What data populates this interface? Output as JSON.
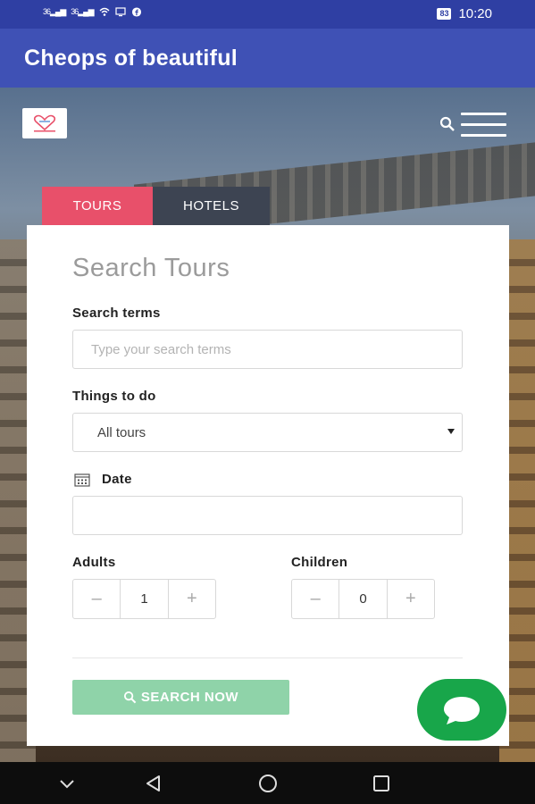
{
  "status_bar": {
    "signal_1": "36",
    "signal_2": "36",
    "battery": "83",
    "time": "10:20",
    "icons": [
      "signal-icon",
      "signal-icon",
      "wifi-icon",
      "screen-cast-icon",
      "facebook-icon"
    ]
  },
  "app_bar": {
    "title": "Cheops of beautiful"
  },
  "tabs": [
    {
      "label": "TOURS",
      "active": true
    },
    {
      "label": "HOTELS",
      "active": false
    }
  ],
  "form": {
    "title": "Search Tours",
    "search_terms_label": "Search terms",
    "search_terms_placeholder": "Type your search terms",
    "things_to_do_label": "Things to do",
    "things_to_do_value": "All tours",
    "date_label": "Date",
    "date_value": "",
    "adults_label": "Adults",
    "adults_value": "1",
    "children_label": "Children",
    "children_value": "0",
    "minus": "–",
    "plus": "+",
    "search_button": "SEARCH NOW"
  },
  "colors": {
    "status_bar": "#2f3fa3",
    "app_bar": "#3f51b5",
    "tab_active": "#e8506a",
    "tab_inactive": "#3d4452",
    "search_button": "#8fd3a9",
    "chat_button": "#18a64a"
  },
  "icons": {
    "logo": "logo-icon",
    "search": "search-icon",
    "menu": "hamburger-menu-icon",
    "calendar": "calendar-icon",
    "chat": "chat-icon",
    "nav": [
      "chevron-down-icon",
      "back-icon",
      "home-icon",
      "recents-icon"
    ]
  }
}
